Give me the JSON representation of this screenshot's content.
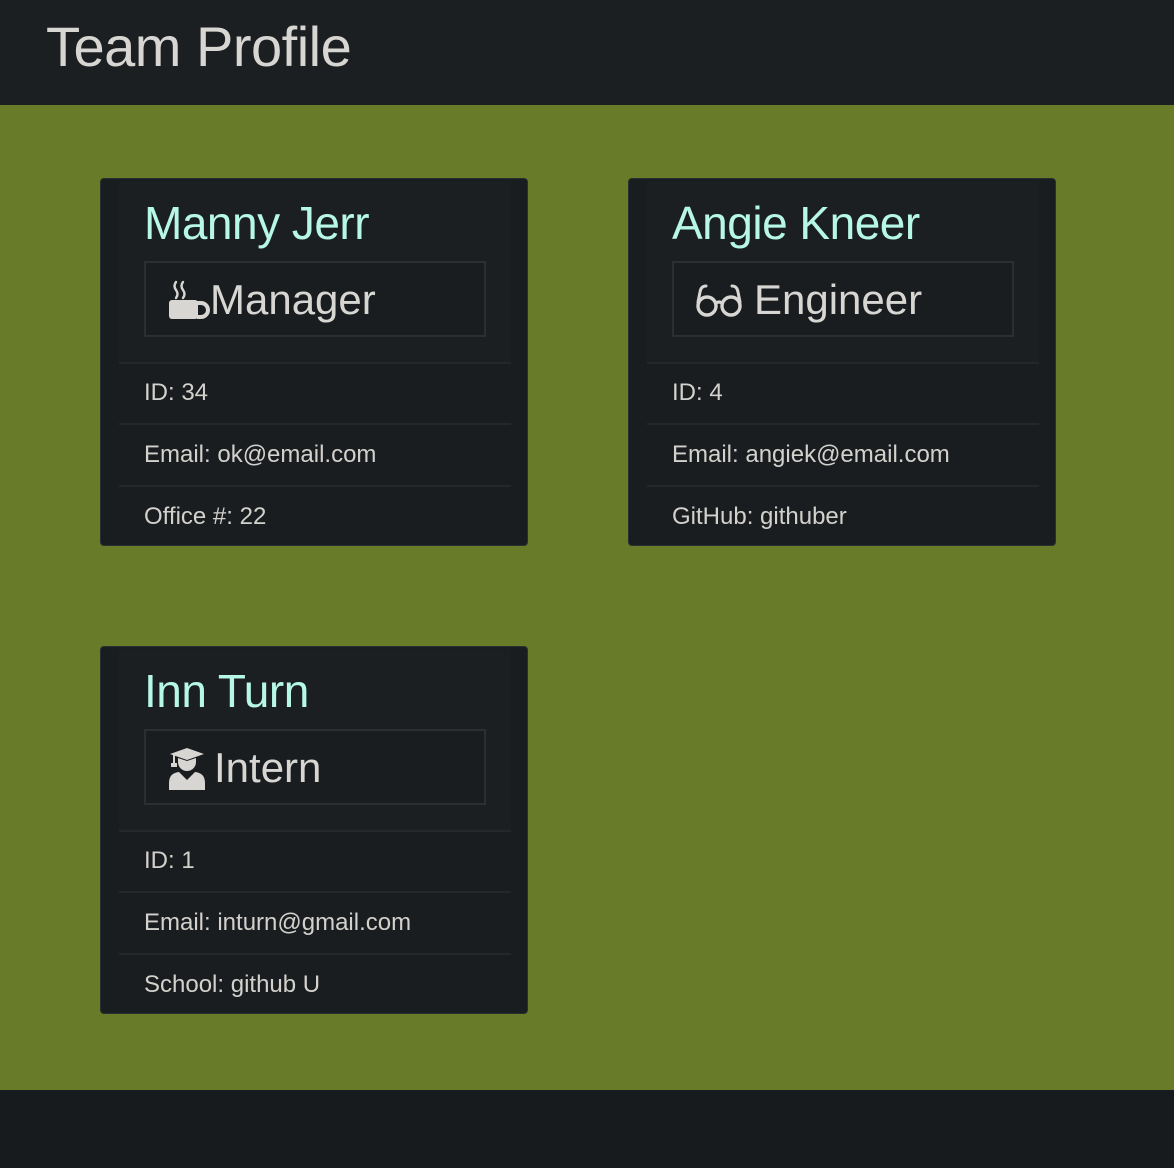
{
  "header": {
    "title": "Team Profile"
  },
  "team": [
    {
      "name": "Manny Jerr",
      "role": "Manager",
      "role_icon": "mug-hot-icon",
      "id_text": "ID: 34",
      "email_text": "Email: ok@email.com",
      "extra_text": "Office #: 22"
    },
    {
      "name": "Angie Kneer",
      "role": "Engineer",
      "role_icon": "glasses-icon",
      "id_text": "ID: 4",
      "email_text": "Email: angiek@email.com",
      "extra_text": "GitHub: githuber"
    },
    {
      "name": "Inn Turn",
      "role": "Intern",
      "role_icon": "user-graduate-icon",
      "id_text": "ID: 1",
      "email_text": "Email: inturn@gmail.com",
      "extra_text": "School: github U"
    }
  ],
  "colors": {
    "header_bg": "#1c1f22",
    "main_bg": "#677b29",
    "name_color": "#b6f7e6",
    "text_color": "#d8d6d2"
  }
}
